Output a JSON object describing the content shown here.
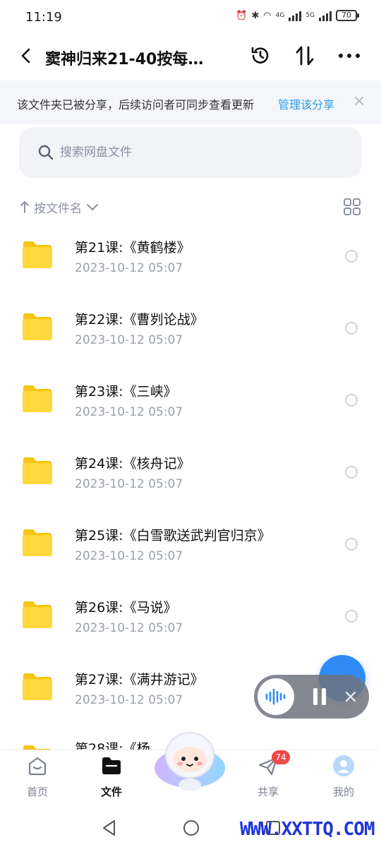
{
  "status_bar": {
    "time": "11:19",
    "network_1": "4G",
    "network_2": "5G",
    "battery": "70"
  },
  "header": {
    "title": "窦神归来21-40按每…"
  },
  "share_banner": {
    "text": "该文件夹已被分享，后续访问者可同步查看更新",
    "link": "管理该分享"
  },
  "search": {
    "placeholder": "搜索网盘文件"
  },
  "sort": {
    "label": "按文件名"
  },
  "files": [
    {
      "name": "第21课:《黄鹤楼》",
      "date": "2023-10-12  05:07"
    },
    {
      "name": "第22课:《曹刿论战》",
      "date": "2023-10-12  05:07"
    },
    {
      "name": "第23课:《三峡》",
      "date": "2023-10-12  05:07"
    },
    {
      "name": "第24课:《核舟记》",
      "date": "2023-10-12  05:07"
    },
    {
      "name": "第25课:《白雪歌送武判官归京》",
      "date": "2023-10-12  05:07"
    },
    {
      "name": "第26课:《马说》",
      "date": "2023-10-12  05:07"
    },
    {
      "name": "第27课:《满井游记》",
      "date": "2023-10-12  05:07"
    }
  ],
  "partial_item": "第28课:《杨",
  "bottom_nav": {
    "home": "首页",
    "files": "文件",
    "share": "共享",
    "share_badge": "74",
    "mine": "我的"
  },
  "watermark": "WWW.XXTTQ.COM",
  "colors": {
    "accent": "#2b9bf0",
    "folder": "#ffd93d",
    "badge": "#f04848"
  }
}
